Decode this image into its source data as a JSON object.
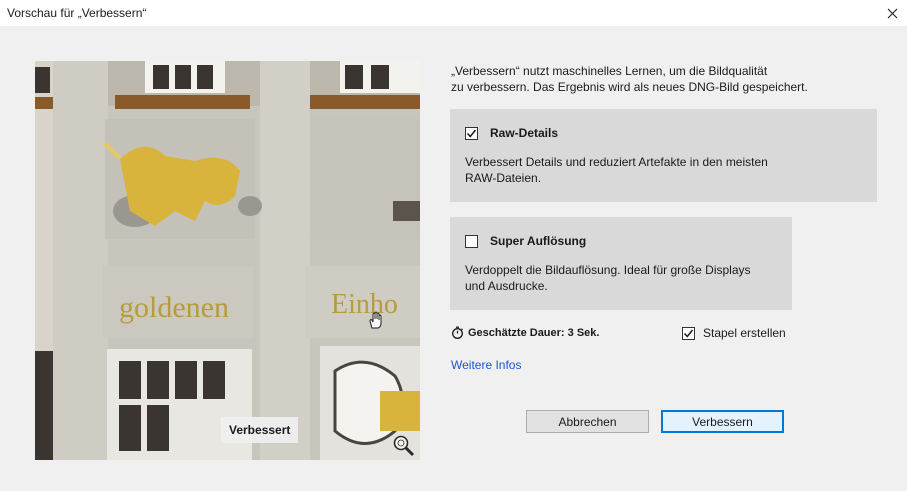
{
  "window": {
    "title": "Vorschau für „Verbessern“"
  },
  "preview": {
    "label": "Verbessert",
    "sign_text_left": "goldenen",
    "sign_text_right": "Einho"
  },
  "description": {
    "line1": "„Verbessern“ nutzt maschinelles Lernen, um die Bildqualität",
    "line2": "zu verbessern. Das Ergebnis wird als neues DNG-Bild gespeichert."
  },
  "options": {
    "raw": {
      "title": "Raw-Details",
      "checked": true,
      "line1": "Verbessert Details und reduziert Artefakte in den meisten",
      "line2": "RAW-Dateien."
    },
    "super": {
      "title": "Super Auflösung",
      "checked": false,
      "line1": "Verdoppelt die Bildauflösung. Ideal für große Displays",
      "line2": "und Ausdrucke."
    }
  },
  "duration": {
    "label": "Geschätzte Dauer: 3 Sek."
  },
  "stack": {
    "label": "Stapel erstellen",
    "checked": true
  },
  "more_info": {
    "label": "Weitere Infos"
  },
  "buttons": {
    "cancel": "Abbrechen",
    "ok": "Verbessern"
  },
  "colors": {
    "link": "#1a55d6",
    "primary_border": "#0078d7",
    "panel_bg": "#d9d9d9",
    "gold": "#d8b43c"
  },
  "icons": {
    "close": "close-icon",
    "checkbox": "checkmark-icon",
    "timer": "stopwatch-icon",
    "zoom": "zoom-icon",
    "hand": "hand-cursor-icon"
  }
}
